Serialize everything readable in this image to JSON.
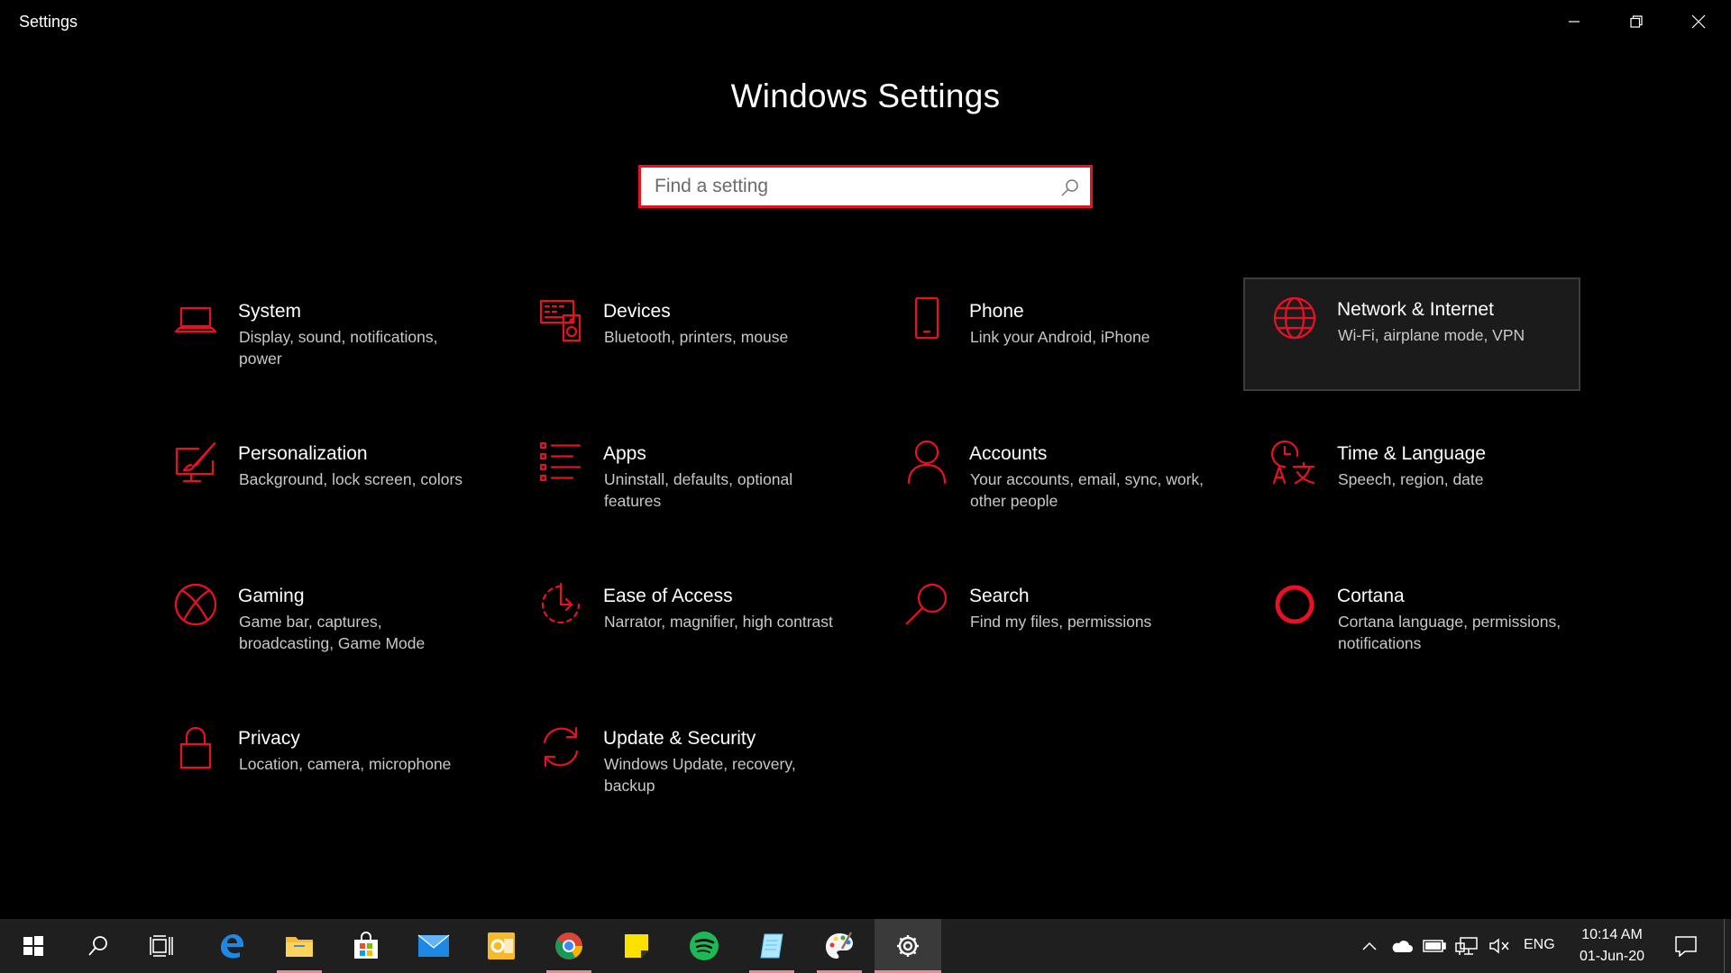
{
  "window": {
    "title": "Settings",
    "minimize_icon": "minimize-icon",
    "maximize_icon": "restore-icon",
    "close_icon": "close-icon"
  },
  "header": {
    "title": "Windows Settings",
    "search_placeholder": "Find a setting"
  },
  "accent_color": "#e81123",
  "tiles": [
    {
      "title": "System",
      "desc": "Display, sound, notifications, power",
      "icon": "laptop-icon"
    },
    {
      "title": "Devices",
      "desc": "Bluetooth, printers, mouse",
      "icon": "devices-icon"
    },
    {
      "title": "Phone",
      "desc": "Link your Android, iPhone",
      "icon": "phone-icon"
    },
    {
      "title": "Network & Internet",
      "desc": "Wi-Fi, airplane mode, VPN",
      "icon": "globe-icon"
    },
    {
      "title": "Personalization",
      "desc": "Background, lock screen, colors",
      "icon": "paint-icon"
    },
    {
      "title": "Apps",
      "desc": "Uninstall, defaults, optional features",
      "icon": "apps-list-icon"
    },
    {
      "title": "Accounts",
      "desc": "Your accounts, email, sync, work, other people",
      "icon": "person-icon"
    },
    {
      "title": "Time & Language",
      "desc": "Speech, region, date",
      "icon": "time-language-icon"
    },
    {
      "title": "Gaming",
      "desc": "Game bar, captures, broadcasting, Game Mode",
      "icon": "xbox-icon"
    },
    {
      "title": "Ease of Access",
      "desc": "Narrator, magnifier, high contrast",
      "icon": "ease-of-access-icon"
    },
    {
      "title": "Search",
      "desc": "Find my files, permissions",
      "icon": "search-magnifier-icon"
    },
    {
      "title": "Cortana",
      "desc": "Cortana language, permissions, notifications",
      "icon": "cortana-icon"
    },
    {
      "title": "Privacy",
      "desc": "Location, camera, microphone",
      "icon": "lock-icon"
    },
    {
      "title": "Update & Security",
      "desc": "Windows Update, recovery, backup",
      "icon": "update-icon"
    }
  ],
  "taskbar": {
    "apps": [
      "start-icon",
      "search-icon",
      "task-view-icon",
      "edge-icon",
      "file-explorer-icon",
      "store-icon",
      "mail-icon",
      "outlook-icon",
      "chrome-icon",
      "sticky-notes-icon",
      "spotify-icon",
      "notepad-icon",
      "paint-icon",
      "settings-icon"
    ],
    "tray": [
      "chevron-up-icon",
      "onedrive-icon",
      "battery-icon",
      "network-icon",
      "volume-muted-icon"
    ],
    "language": "ENG",
    "time": "10:14 AM",
    "date": "01-Jun-20"
  }
}
